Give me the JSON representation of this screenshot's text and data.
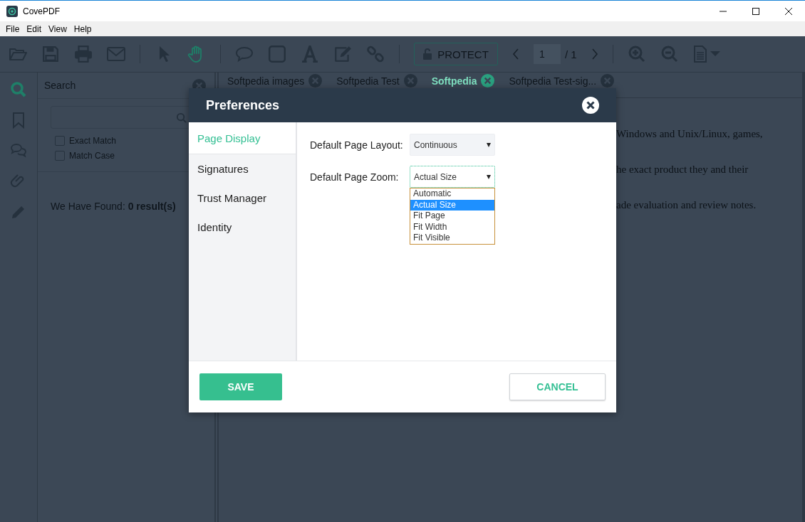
{
  "window": {
    "title": "CovePDF"
  },
  "menu": [
    "File",
    "Edit",
    "View",
    "Help"
  ],
  "toolbar": {
    "tools": [
      {
        "selected": false
      },
      {
        "selected": true
      }
    ],
    "protect": "PROTECT",
    "page": "1",
    "page_total": "/ 1"
  },
  "rail": [
    {
      "selected": true
    },
    {
      "selected": false
    },
    {
      "selected": false
    },
    {
      "selected": false
    },
    {
      "selected": false
    }
  ],
  "search_panel": {
    "title": "Search",
    "options": [
      {
        "label": "Exact Match",
        "checked": false
      },
      {
        "label": "Match Case",
        "checked": false
      }
    ],
    "result": "We Have Found: **0 result(s)**"
  },
  "tabs": [
    {
      "label": "Softpedia images",
      "selected": false
    },
    {
      "label": "Softpedia Test",
      "selected": false
    },
    {
      "label": "Softpedia",
      "selected": true
    },
    {
      "label": "Softpedia Test-sig...",
      "selected": false
    }
  ],
  "document": {
    "lines": [
      "Windows and Unix/Linux, games,",
      "he exact product they and their",
      "ade evaluation and review notes."
    ]
  },
  "dialog": {
    "title": "Preferences",
    "nav": [
      {
        "label": "Page Display",
        "selected": true
      },
      {
        "label": "Signatures",
        "selected": false
      },
      {
        "label": "Trust Manager",
        "selected": false
      },
      {
        "label": "Identity",
        "selected": false
      }
    ],
    "fields": [
      {
        "label": "Default Page Layout:",
        "value": "Continuous",
        "expanded": false
      },
      {
        "label": "Default Page Zoom:",
        "value": "Actual Size",
        "expanded": true,
        "options": [
          {
            "label": "Automatic",
            "selected": false
          },
          {
            "label": "Actual Size",
            "selected": true
          },
          {
            "label": "Fit Page",
            "selected": false
          },
          {
            "label": "Fit Width",
            "selected": false
          },
          {
            "label": "Fit Visible",
            "selected": false
          }
        ]
      }
    ],
    "buttons": [
      {
        "label": "SAVE",
        "kind": "primary"
      },
      {
        "label": "CANCEL",
        "kind": "secondary"
      }
    ]
  }
}
